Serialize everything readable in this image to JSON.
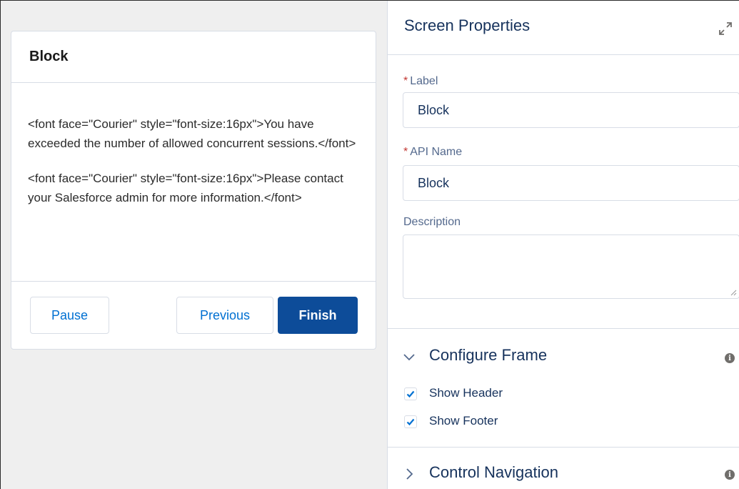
{
  "canvas": {
    "card_title": "Block",
    "paragraphs": [
      "<font face=\"Courier\" style=\"font-size:16px\">You have exceeded the number of allowed concurrent sessions.</font>",
      "<font face=\"Courier\" style=\"font-size:16px\">Please contact your Salesforce admin for more information.</font>"
    ],
    "buttons": {
      "pause": "Pause",
      "previous": "Previous",
      "finish": "Finish"
    }
  },
  "panel": {
    "title": "Screen Properties",
    "label_field": {
      "label": "Label",
      "required_mark": "*",
      "value": "Block"
    },
    "api_name_field": {
      "label": "API Name",
      "required_mark": "*",
      "value": "Block"
    },
    "description_field": {
      "label": "Description",
      "value": ""
    },
    "configure_frame": {
      "title": "Configure Frame",
      "show_header": {
        "label": "Show Header",
        "checked": true
      },
      "show_footer": {
        "label": "Show Footer",
        "checked": true
      }
    },
    "control_navigation": {
      "title": "Control Navigation"
    }
  },
  "colors": {
    "brand_button": "#0d4c99",
    "link_blue": "#0070d2",
    "required_red": "#c23934",
    "canvas_bg": "#efefef"
  },
  "icons": [
    "expand-icon",
    "chevron-down-icon",
    "chevron-right-icon",
    "info-icon",
    "checkmark-icon",
    "resize-handle-icon"
  ]
}
